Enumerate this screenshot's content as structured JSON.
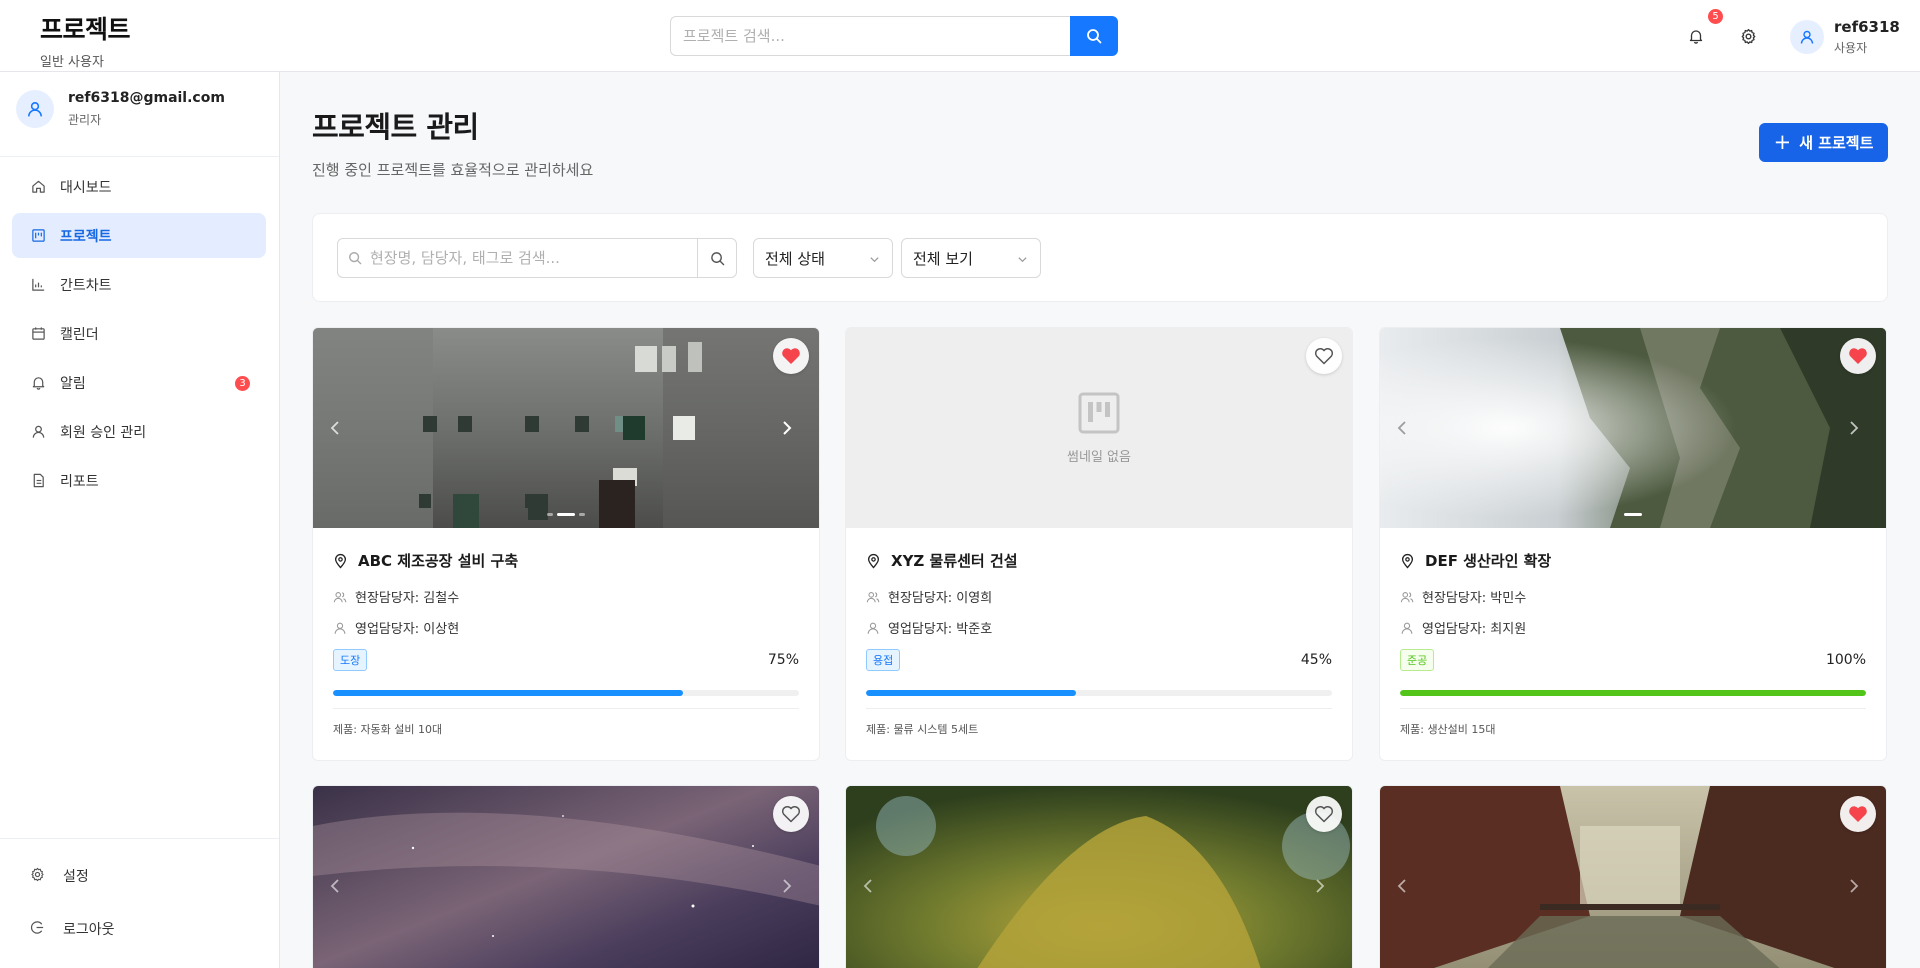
{
  "header": {
    "brand_title": "프로젝트",
    "brand_sub": "일반 사용자",
    "search_placeholder": "프로젝트 검색...",
    "notification_count": "5",
    "user_name": "ref6318",
    "user_role": "사용자"
  },
  "sidebar": {
    "user_email": "ref6318@gmail.com",
    "user_role": "관리자",
    "items": [
      {
        "label": "대시보드",
        "icon": "home-icon"
      },
      {
        "label": "프로젝트",
        "icon": "project-board-icon",
        "active": true
      },
      {
        "label": "간트차트",
        "icon": "bar-chart-icon"
      },
      {
        "label": "캘린더",
        "icon": "calendar-icon"
      },
      {
        "label": "알림",
        "icon": "bell-icon",
        "badge": "3"
      },
      {
        "label": "회원 승인 관리",
        "icon": "user-check-icon"
      },
      {
        "label": "리포트",
        "icon": "report-file-icon"
      }
    ],
    "settings_label": "설정",
    "logout_label": "로그아웃"
  },
  "main": {
    "title": "프로젝트 관리",
    "subtitle": "진행 중인 프로젝트를 효율적으로 관리하세요",
    "new_button_label": "새 프로젝트",
    "filter": {
      "search_placeholder": "현장명, 담당자, 태그로 검색...",
      "status_select": "전체 상태",
      "view_select": "전체 보기"
    }
  },
  "projects": [
    {
      "title": "ABC 제조공장 설비 구축",
      "site_manager": "현장담당자: 김철수",
      "sales_manager": "영업담당자: 이상현",
      "tag": "도장",
      "progress": 75,
      "progress_label": "75%",
      "product": "제품: 자동화 설비 10대",
      "favorite": true,
      "thumbnail": "weathered-building-photo"
    },
    {
      "title": "XYZ 물류센터 건설",
      "site_manager": "현장담당자: 이영희",
      "sales_manager": "영업담당자: 박준호",
      "tag": "용접",
      "progress": 45,
      "progress_label": "45%",
      "product": "제품: 물류 시스템 5세트",
      "favorite": false,
      "no_thumbnail_label": "썸네일 없음"
    },
    {
      "title": "DEF 생산라인 확장",
      "site_manager": "현장담당자: 박민수",
      "sales_manager": "영업담당자: 최지원",
      "tag": "준공",
      "progress": 100,
      "progress_label": "100%",
      "product": "제품: 생산설비 15대",
      "favorite": true,
      "thumbnail": "misty-cliff-photo"
    },
    {
      "favorite": false,
      "thumbnail": "night-sky-photo"
    },
    {
      "favorite": false,
      "thumbnail": "moss-tree-photo"
    },
    {
      "favorite": true,
      "thumbnail": "canal-buildings-photo"
    }
  ],
  "colors": {
    "primary": "#1677ff",
    "button_blue": "#1764e8",
    "progress_blue": "#1890ff",
    "progress_green": "#52c41a",
    "favorite_red": "#f5444b",
    "badge_red": "#ff4d4f"
  }
}
